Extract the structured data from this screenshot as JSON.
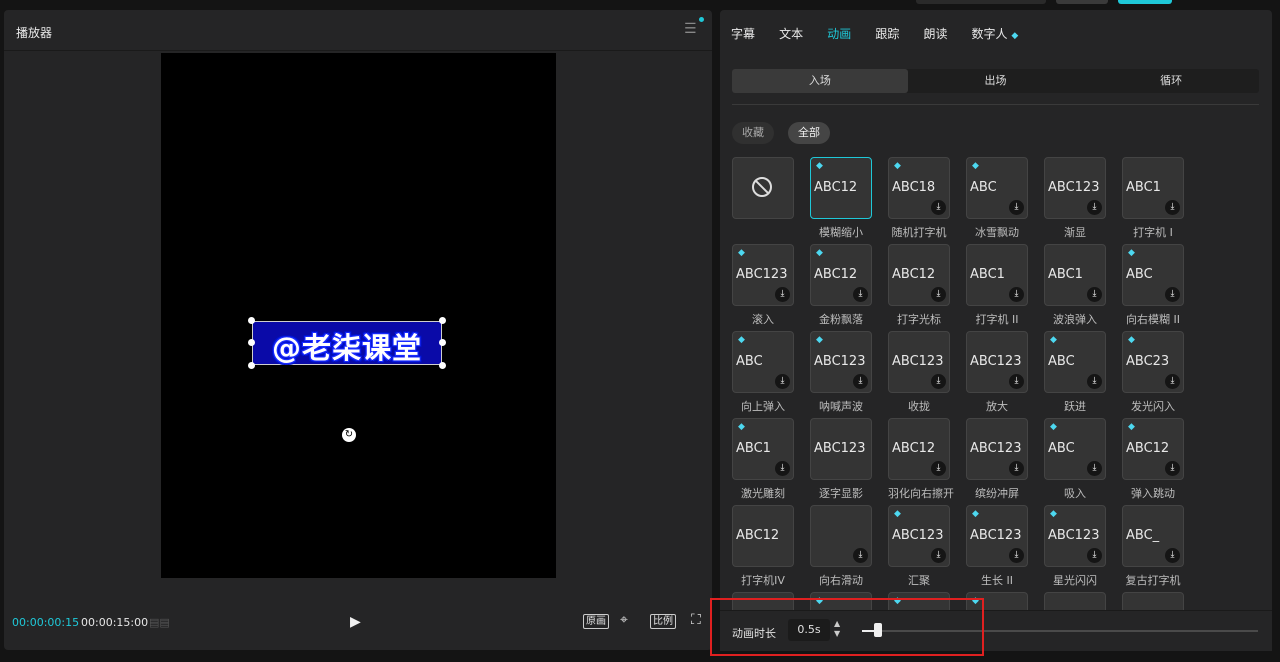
{
  "player": {
    "title": "播放器",
    "watermark": "@老柒课堂",
    "time_current": "00:00:00:15",
    "time_total": "00:00:15:00",
    "ctrl_original": "原画",
    "ctrl_ratio": "比例"
  },
  "side": {
    "tabs": [
      "字幕",
      "文本",
      "动画",
      "跟踪",
      "朗读",
      "数字人"
    ],
    "active_tab": "动画",
    "segments": [
      "入场",
      "出场",
      "循环"
    ],
    "active_segment": "入场",
    "chips": [
      "收藏",
      "全部"
    ],
    "active_chip": "全部"
  },
  "grid": [
    {
      "name": "",
      "thumb": "none",
      "diamond": false,
      "download": false,
      "selected": false
    },
    {
      "name": "模糊缩小",
      "thumb": "ABC12",
      "diamond": true,
      "download": false,
      "selected": true
    },
    {
      "name": "随机打字机",
      "thumb": "ABC18",
      "diamond": true,
      "download": true,
      "selected": false
    },
    {
      "name": "冰雪飘动",
      "thumb": "ABC",
      "diamond": true,
      "download": true,
      "selected": false
    },
    {
      "name": "渐显",
      "thumb": "ABC123",
      "diamond": false,
      "download": true,
      "selected": false
    },
    {
      "name": "打字机 I",
      "thumb": "ABC1",
      "diamond": false,
      "download": true,
      "selected": false
    },
    {
      "name": "滚入",
      "thumb": "ABC123",
      "diamond": true,
      "download": true,
      "selected": false
    },
    {
      "name": "金粉飘落",
      "thumb": "ABC12",
      "diamond": true,
      "download": true,
      "selected": false
    },
    {
      "name": "打字光标",
      "thumb": "ABC12",
      "diamond": false,
      "download": true,
      "selected": false
    },
    {
      "name": "打字机 II",
      "thumb": "ABC1",
      "diamond": false,
      "download": true,
      "selected": false
    },
    {
      "name": "波浪弹入",
      "thumb": "ABC1",
      "diamond": false,
      "download": true,
      "selected": false
    },
    {
      "name": "向右模糊 II",
      "thumb": "ABC",
      "diamond": true,
      "download": true,
      "selected": false
    },
    {
      "name": "向上弹入",
      "thumb": "ABC",
      "diamond": true,
      "download": true,
      "selected": false
    },
    {
      "name": "呐喊声波",
      "thumb": "ABC123",
      "diamond": true,
      "download": true,
      "selected": false
    },
    {
      "name": "收拢",
      "thumb": "ABC123",
      "diamond": false,
      "download": true,
      "selected": false
    },
    {
      "name": "放大",
      "thumb": "ABC123",
      "diamond": false,
      "download": true,
      "selected": false
    },
    {
      "name": "跃进",
      "thumb": "ABC",
      "diamond": true,
      "download": true,
      "selected": false
    },
    {
      "name": "发光闪入",
      "thumb": "ABC23",
      "diamond": true,
      "download": true,
      "selected": false
    },
    {
      "name": "激光雕刻",
      "thumb": "ABC1",
      "diamond": true,
      "download": true,
      "selected": false
    },
    {
      "name": "逐字显影",
      "thumb": "ABC123",
      "diamond": false,
      "download": false,
      "selected": false
    },
    {
      "name": "羽化向右擦开",
      "thumb": "ABC12",
      "diamond": false,
      "download": true,
      "selected": false
    },
    {
      "name": "缤纷冲屏",
      "thumb": "ABC123",
      "diamond": false,
      "download": true,
      "selected": false
    },
    {
      "name": "吸入",
      "thumb": "ABC",
      "diamond": true,
      "download": true,
      "selected": false
    },
    {
      "name": "弹入跳动",
      "thumb": "ABC12",
      "diamond": true,
      "download": true,
      "selected": false
    },
    {
      "name": "打字机IV",
      "thumb": "ABC12",
      "diamond": false,
      "download": false,
      "selected": false
    },
    {
      "name": "向右滑动",
      "thumb": "",
      "diamond": false,
      "download": true,
      "selected": false
    },
    {
      "name": "汇聚",
      "thumb": "ABC123",
      "diamond": true,
      "download": true,
      "selected": false
    },
    {
      "name": "生长 II",
      "thumb": "ABC123",
      "diamond": true,
      "download": true,
      "selected": false
    },
    {
      "name": "星光闪闪",
      "thumb": "ABC123",
      "diamond": true,
      "download": true,
      "selected": false
    },
    {
      "name": "复古打字机",
      "thumb": "ABC_",
      "diamond": false,
      "download": true,
      "selected": false
    },
    {
      "name": "",
      "thumb": "",
      "diamond": false,
      "download": false,
      "selected": false
    },
    {
      "name": "",
      "thumb": "",
      "diamond": true,
      "download": false,
      "selected": false
    },
    {
      "name": "",
      "thumb": "",
      "diamond": true,
      "download": false,
      "selected": false
    },
    {
      "name": "",
      "thumb": "",
      "diamond": true,
      "download": false,
      "selected": false
    },
    {
      "name": "",
      "thumb": "",
      "diamond": false,
      "download": false,
      "selected": false
    },
    {
      "name": "",
      "thumb": "",
      "diamond": false,
      "download": false,
      "selected": false
    }
  ],
  "footer": {
    "label": "动画时长",
    "value": "0.5s",
    "slider_fraction": 0.03
  },
  "colors": {
    "accent": "#1fc8d8",
    "panel": "#252526",
    "highlight": "#e02020"
  }
}
